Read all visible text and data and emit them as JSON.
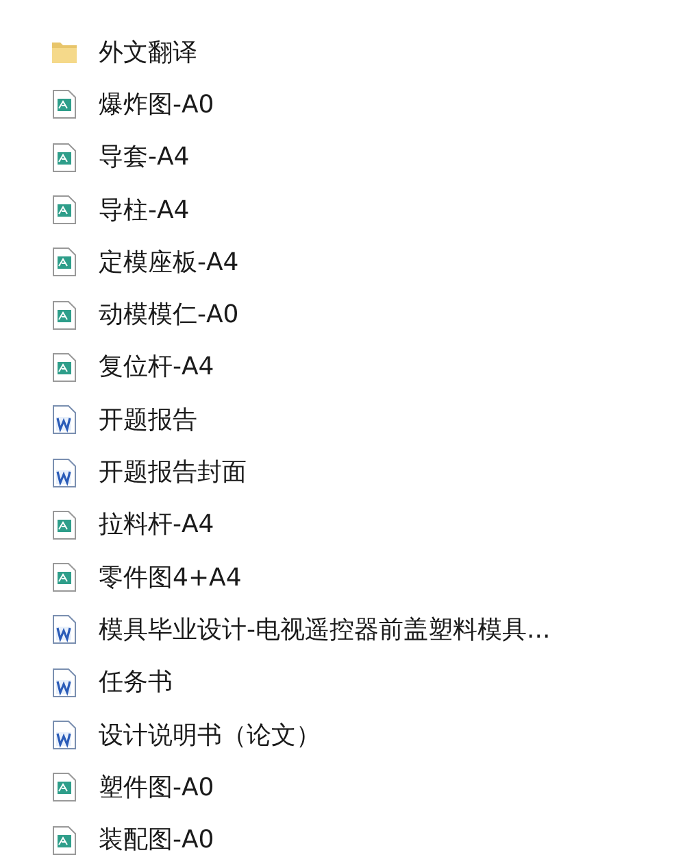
{
  "files": [
    {
      "kind": "folder",
      "name": "外文翻译"
    },
    {
      "kind": "drawing",
      "name": "爆炸图-A0"
    },
    {
      "kind": "drawing",
      "name": "导套-A4"
    },
    {
      "kind": "drawing",
      "name": "导柱-A4"
    },
    {
      "kind": "drawing",
      "name": "定模座板-A4"
    },
    {
      "kind": "drawing",
      "name": "动模模仁-A0"
    },
    {
      "kind": "drawing",
      "name": "复位杆-A4"
    },
    {
      "kind": "word",
      "name": "开题报告"
    },
    {
      "kind": "word",
      "name": "开题报告封面"
    },
    {
      "kind": "drawing",
      "name": "拉料杆-A4"
    },
    {
      "kind": "drawing",
      "name": "零件图4+A4"
    },
    {
      "kind": "word",
      "name": "模具毕业设计-电视遥控器前盖塑料模具..."
    },
    {
      "kind": "word",
      "name": "任务书"
    },
    {
      "kind": "word",
      "name": "设计说明书（论文）"
    },
    {
      "kind": "drawing",
      "name": "塑件图-A0"
    },
    {
      "kind": "drawing",
      "name": "装配图-A0"
    }
  ]
}
